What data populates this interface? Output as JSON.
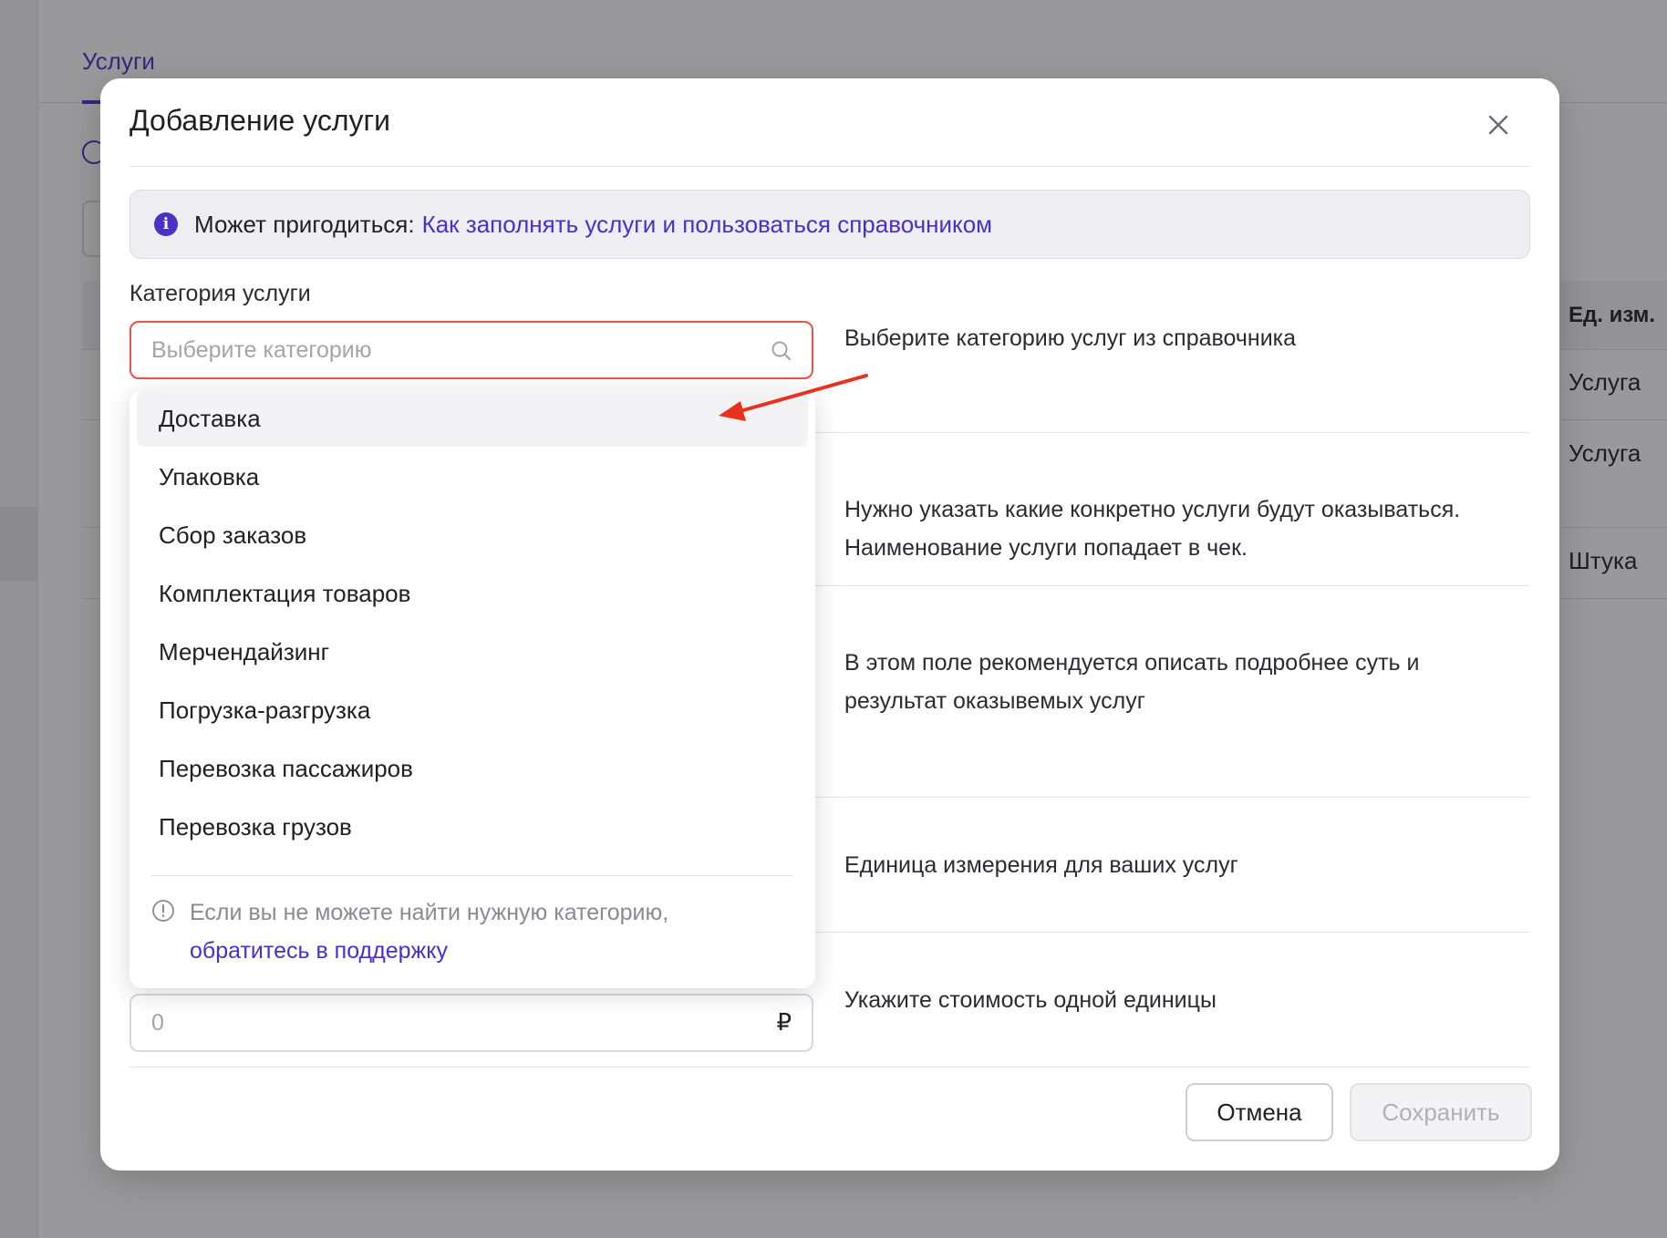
{
  "background": {
    "tab_label": "Услуги",
    "table": {
      "column_header": "Ед. изм.",
      "rows": [
        "Услуга",
        "Услуга",
        "Штука"
      ]
    }
  },
  "modal": {
    "title": "Добавление услуги",
    "info": {
      "prefix": "Может пригодиться:",
      "link": "Как заполнять услуги и пользоваться справочником"
    },
    "category": {
      "label": "Категория услуги",
      "placeholder": "Выберите категорию",
      "hint": "Выберите категорию услуг из справочника",
      "options": [
        "Доставка",
        "Упаковка",
        "Сбор заказов",
        "Комплектация товаров",
        "Мерчендайзинг",
        "Погрузка-разгрузка",
        "Перевозка пассажиров",
        "Перевозка грузов"
      ],
      "highlighted_option": "Доставка",
      "footer_text": "Если вы не можете найти нужную категорию,",
      "footer_link": "обратитесь в поддержку"
    },
    "hints": {
      "name": "Нужно указать какие конкретно услуги будут оказываться. Наименование услуги попадает в чек.",
      "description": "В этом поле рекомендуется описать подробнее суть и результат оказывемых услуг",
      "unit": "Единица измерения для ваших услуг",
      "price": "Укажите стоимость одной единицы"
    },
    "price": {
      "placeholder": "0",
      "currency_symbol": "₽"
    },
    "buttons": {
      "cancel": "Отмена",
      "save": "Сохранить"
    }
  },
  "colors": {
    "accent": "#4a2fc8",
    "error_border": "#f0504a",
    "annotation_arrow": "#e8321e"
  },
  "icons": [
    "close-icon",
    "info-icon",
    "search-icon",
    "alert-circle-icon",
    "ruble-icon"
  ]
}
